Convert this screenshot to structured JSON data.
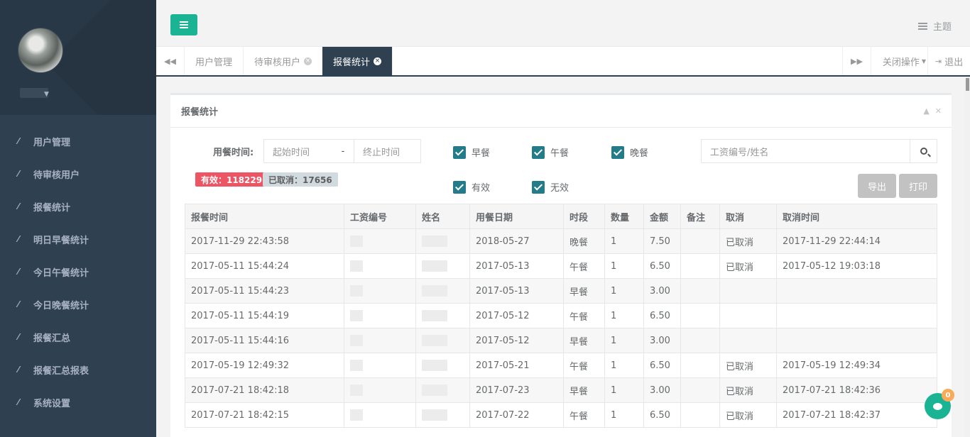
{
  "sidebar": {
    "items": [
      {
        "label": "用户管理"
      },
      {
        "label": "待审核用户"
      },
      {
        "label": "报餐统计"
      },
      {
        "label": "明日早餐统计"
      },
      {
        "label": "今日午餐统计"
      },
      {
        "label": "今日晚餐统计"
      },
      {
        "label": "报餐汇总"
      },
      {
        "label": "报餐汇总报表"
      },
      {
        "label": "系统设置"
      }
    ]
  },
  "header": {
    "theme_label": "主题"
  },
  "tabs": {
    "items": [
      {
        "label": "用户管理"
      },
      {
        "label": "待审核用户"
      },
      {
        "label": "报餐统计"
      }
    ],
    "close_ops_label": "关闭操作",
    "logout_label": "退出"
  },
  "panel": {
    "title": "报餐统计",
    "filter_label": "用餐时间:",
    "start_placeholder": "起始时间",
    "separator": "-",
    "end_placeholder": "终止时间",
    "checkboxes": [
      {
        "label": "早餐",
        "checked": true
      },
      {
        "label": "午餐",
        "checked": true
      },
      {
        "label": "晚餐",
        "checked": true
      },
      {
        "label": "有效",
        "checked": true
      },
      {
        "label": "无效",
        "checked": true
      }
    ],
    "search_placeholder": "工资编号/姓名",
    "badge_valid": "有效：118229",
    "badge_cancelled": "已取消：17656",
    "export_label": "导出",
    "print_label": "打印"
  },
  "table": {
    "columns": [
      "报餐时间",
      "工资编号",
      "姓名",
      "用餐日期",
      "时段",
      "数量",
      "金额",
      "备注",
      "取消",
      "取消时间"
    ],
    "rows": [
      [
        "2017-11-29 22:43:58",
        "",
        "",
        "2018-05-27",
        "晚餐",
        "1",
        "7.50",
        "",
        "已取消",
        "2017-11-29 22:44:14"
      ],
      [
        "2017-05-11 15:44:24",
        "",
        "",
        "2017-05-13",
        "午餐",
        "1",
        "6.50",
        "",
        "已取消",
        "2017-05-12 19:03:18"
      ],
      [
        "2017-05-11 15:44:23",
        "",
        "",
        "2017-05-13",
        "早餐",
        "1",
        "3.00",
        "",
        "",
        ""
      ],
      [
        "2017-05-11 15:44:19",
        "",
        "",
        "2017-05-12",
        "午餐",
        "1",
        "6.50",
        "",
        "",
        ""
      ],
      [
        "2017-05-11 15:44:16",
        "",
        "",
        "2017-05-12",
        "早餐",
        "1",
        "3.00",
        "",
        "",
        ""
      ],
      [
        "2017-05-19 12:49:32",
        "",
        "",
        "2017-05-21",
        "午餐",
        "1",
        "6.50",
        "",
        "已取消",
        "2017-05-19 12:49:34"
      ],
      [
        "2017-07-21 18:42:18",
        "",
        "",
        "2017-07-23",
        "早餐",
        "1",
        "3.00",
        "",
        "已取消",
        "2017-07-21 18:42:36"
      ],
      [
        "2017-07-21 18:42:15",
        "",
        "",
        "2017-07-22",
        "午餐",
        "1",
        "6.50",
        "",
        "已取消",
        "2017-07-21 18:42:37"
      ]
    ]
  },
  "chat": {
    "count": "0"
  }
}
